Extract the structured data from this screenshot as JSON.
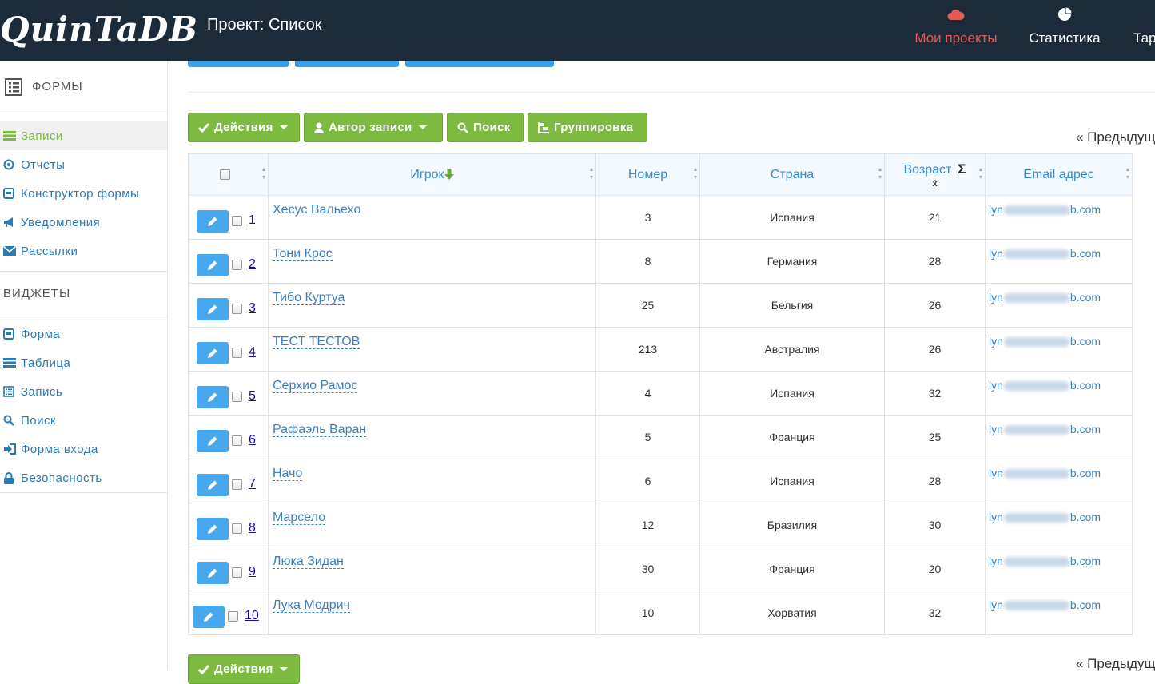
{
  "app": {
    "logo": "QuinTaDB",
    "page_title": "Проект: Список"
  },
  "nav": {
    "projects": "Мои проекты",
    "stats": "Статистика",
    "tariffs": "Тар"
  },
  "sidebar": {
    "forms_heading": "ФОРМЫ",
    "items": [
      {
        "label": "Записи",
        "icon": "list-icon"
      },
      {
        "label": "Отчёты",
        "icon": "circle-dot-icon"
      },
      {
        "label": "Конструктор формы",
        "icon": "form-icon"
      },
      {
        "label": "Уведомления",
        "icon": "megaphone-icon"
      },
      {
        "label": "Рассылки",
        "icon": "envelope-icon"
      }
    ],
    "widgets_heading": "ВИДЖЕТЫ",
    "widgets": [
      {
        "label": "Форма",
        "icon": "form-icon"
      },
      {
        "label": "Таблица",
        "icon": "list-icon"
      },
      {
        "label": "Запись",
        "icon": "record-icon"
      },
      {
        "label": "Поиск",
        "icon": "search-icon"
      },
      {
        "label": "Форма входа",
        "icon": "sign-in-icon"
      },
      {
        "label": "Безопасность",
        "icon": "lock-icon"
      }
    ]
  },
  "toolbar": {
    "actions": "Действия",
    "author": "Автор записи",
    "search": "Поиск",
    "group": "Группировка",
    "prev": "« Предыдущ"
  },
  "table": {
    "columns": {
      "player": "Игрок",
      "number": "Номер",
      "country": "Страна",
      "age": "Возраст",
      "age_sum": "Σ",
      "age_avg": "x̄",
      "email": "Email адрес"
    },
    "email_prefix": "lyn",
    "email_suffix": "b.com",
    "rows": [
      {
        "n": "1",
        "name": "Хесус Вальехо",
        "number": "3",
        "country": "Испания",
        "age": "21"
      },
      {
        "n": "2",
        "name": "Тони Крос",
        "number": "8",
        "country": "Германия",
        "age": "28"
      },
      {
        "n": "3",
        "name": "Тибо Куртуа",
        "number": "25",
        "country": "Бельгия",
        "age": "26"
      },
      {
        "n": "4",
        "name": "ТЕСТ ТЕСТОВ",
        "number": "213",
        "country": "Австралия",
        "age": "26"
      },
      {
        "n": "5",
        "name": "Серхио Рамос",
        "number": "4",
        "country": "Испания",
        "age": "32"
      },
      {
        "n": "6",
        "name": "Рафаэль Варан",
        "number": "5",
        "country": "Франция",
        "age": "25"
      },
      {
        "n": "7",
        "name": "Начо",
        "number": "6",
        "country": "Испания",
        "age": "28"
      },
      {
        "n": "8",
        "name": "Марсело",
        "number": "12",
        "country": "Бразилия",
        "age": "30"
      },
      {
        "n": "9",
        "name": "Люка Зидан",
        "number": "30",
        "country": "Франция",
        "age": "20"
      },
      {
        "n": "10",
        "name": "Лука Модрич",
        "number": "10",
        "country": "Хорватия",
        "age": "32"
      }
    ]
  },
  "colors": {
    "header_bg": "#1b2b3a",
    "accent_green": "#7cbb3f",
    "accent_blue": "#47a8ee",
    "nav_active": "#e05a56"
  }
}
